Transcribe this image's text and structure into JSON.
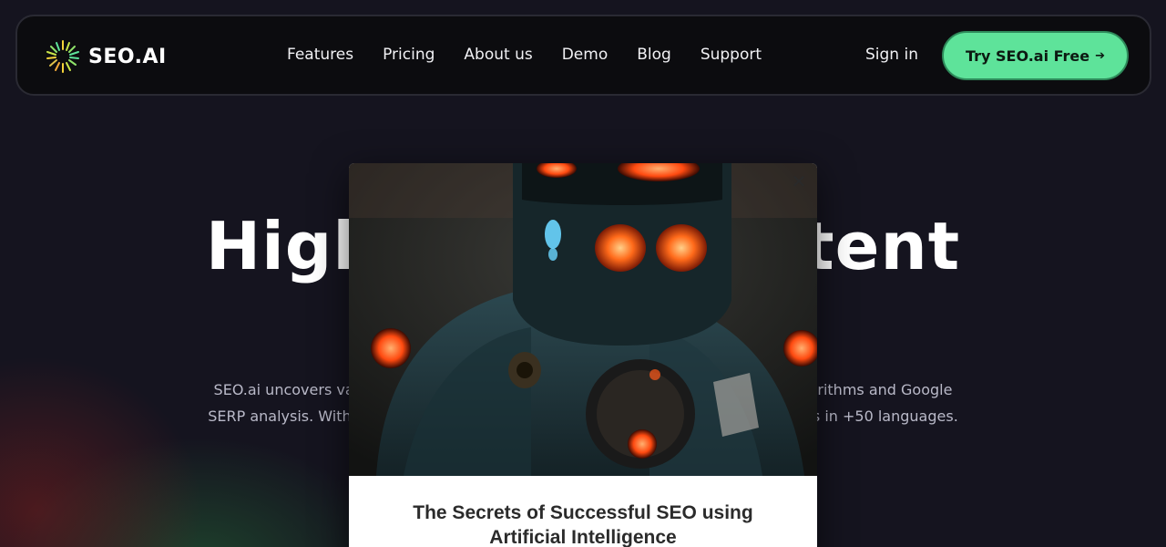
{
  "navbar": {
    "logo_text": "SEO.AI",
    "links": [
      "Features",
      "Pricing",
      "About us",
      "Demo",
      "Blog",
      "Support"
    ],
    "sign_in": "Sign in",
    "cta_label": "Try SEO.ai Free",
    "cta_arrow": "➔"
  },
  "hero": {
    "title_left": "High-",
    "title_right": "ontent",
    "desc_line1_left": "SEO.ai uncovers valuab",
    "desc_line1_right": "algorithms and Google",
    "desc_line2_left": "SERP analysis. With m",
    "desc_line2_right": "orks in +50 languages."
  },
  "modal": {
    "close_icon": "close-icon",
    "title": "The Secrets of Successful SEO using Artificial Intelligence"
  },
  "colors": {
    "accent": "#5ee39a",
    "background": "#15141f"
  }
}
